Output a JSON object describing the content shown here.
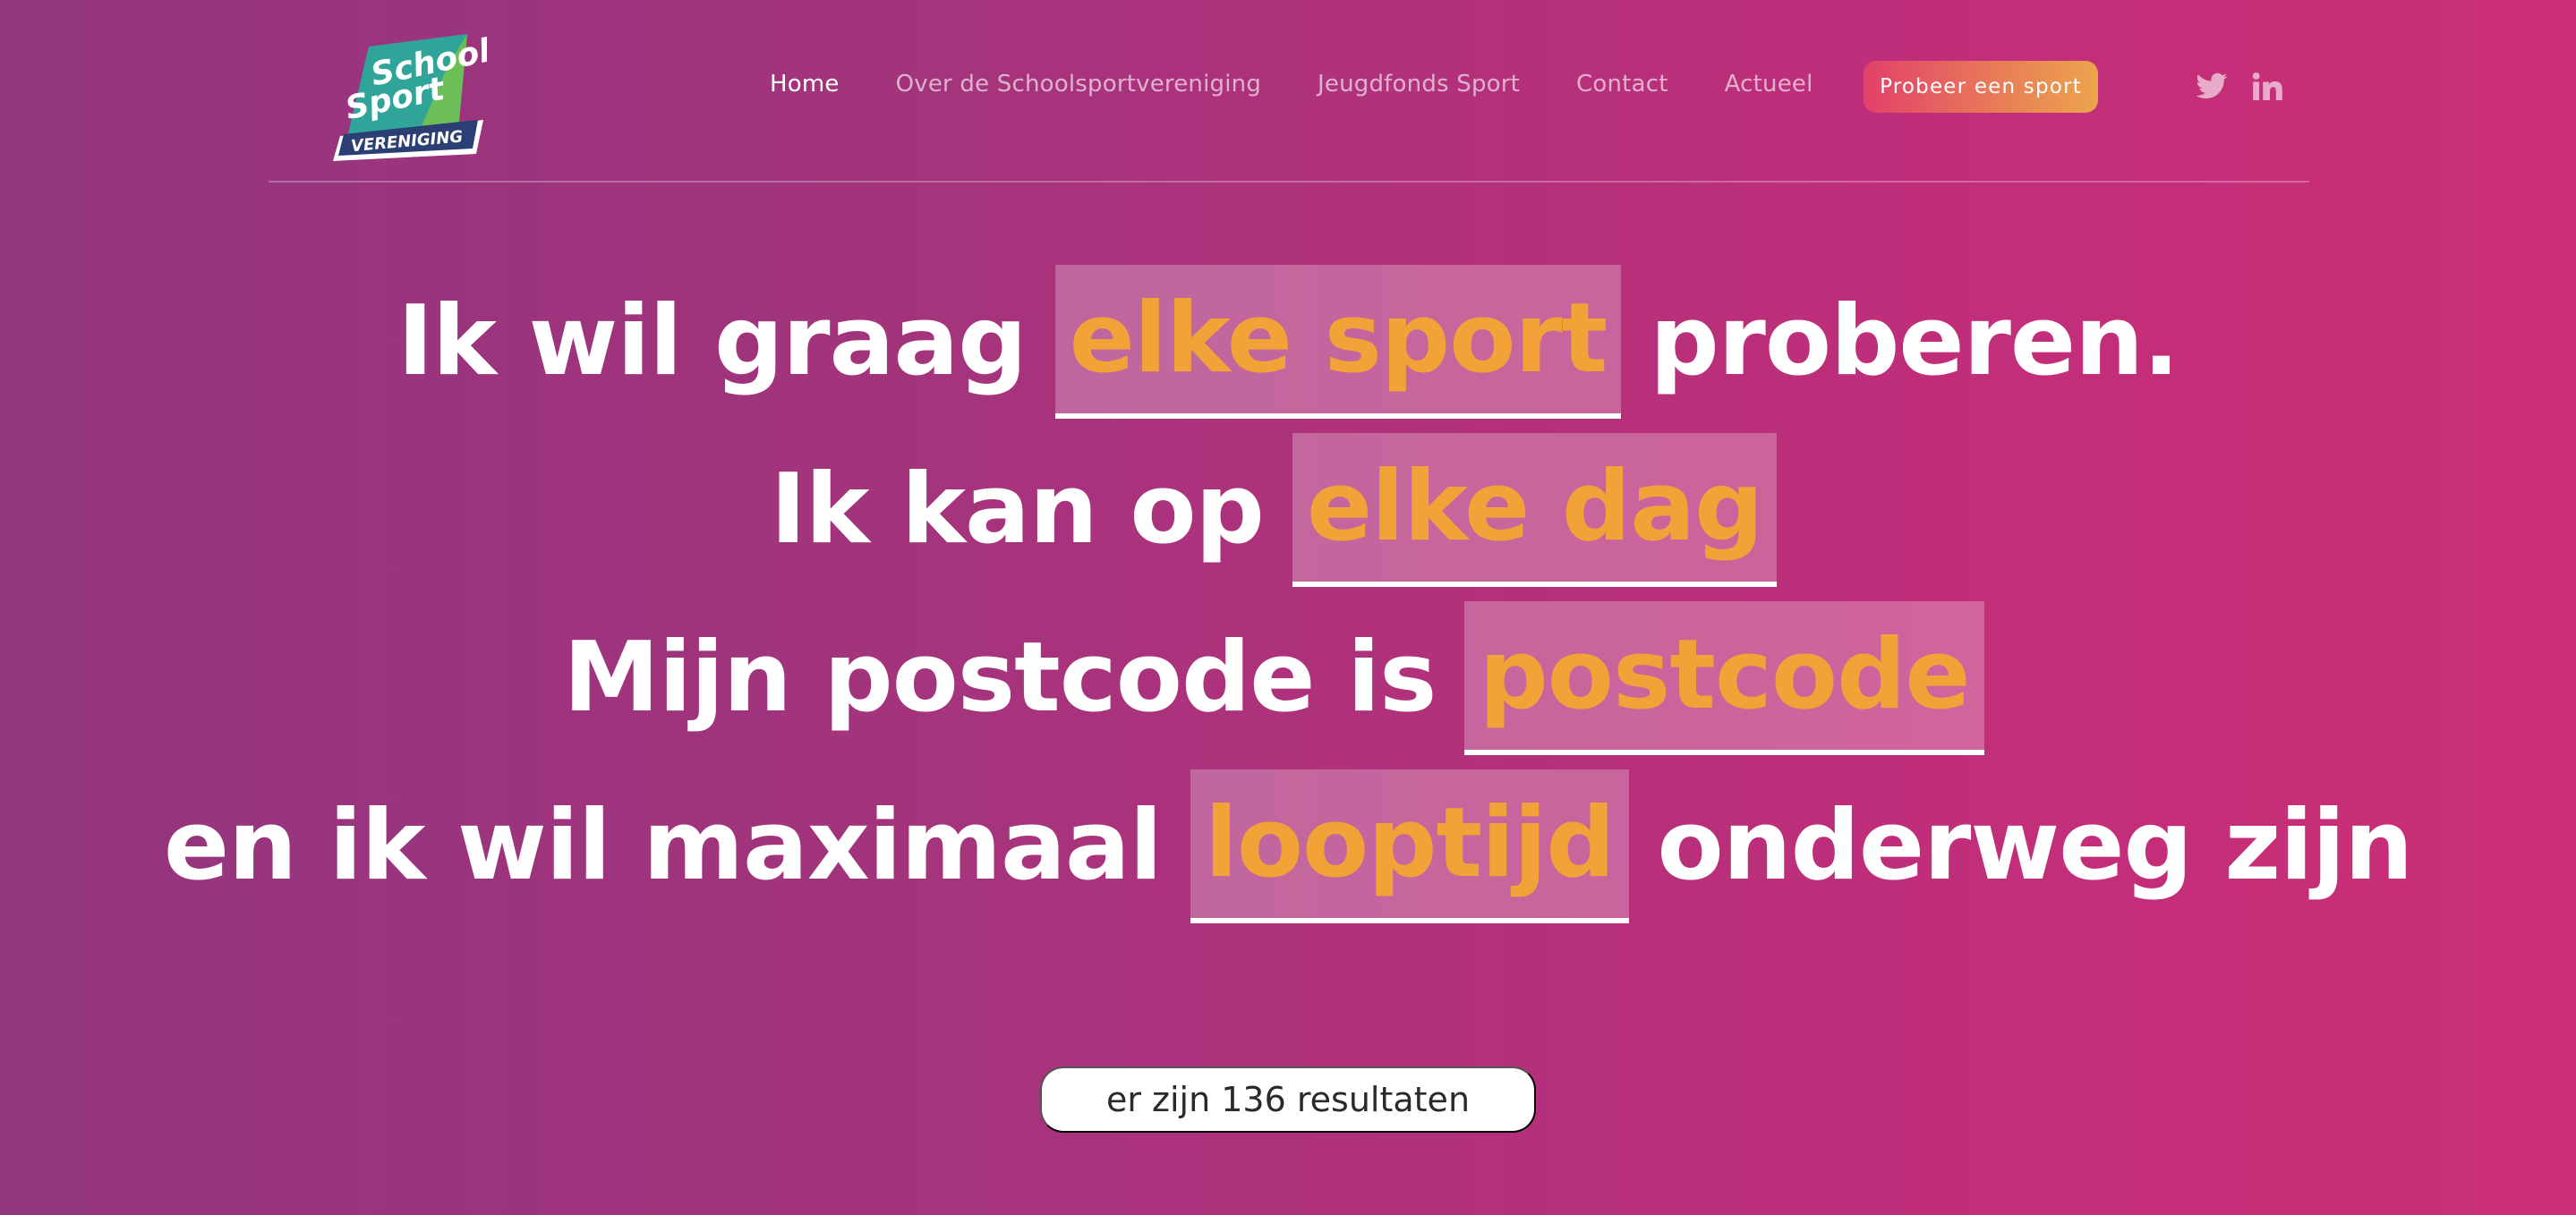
{
  "logo": {
    "line1": "School",
    "line2": "Sport",
    "line3": "VERENIGING"
  },
  "nav": {
    "items": [
      {
        "label": "Home",
        "active": true
      },
      {
        "label": "Over de Schoolsportvereniging",
        "active": false
      },
      {
        "label": "Jeugdfonds Sport",
        "active": false
      },
      {
        "label": "Contact",
        "active": false
      },
      {
        "label": "Actueel",
        "active": false
      }
    ],
    "cta_label": "Probeer een sport"
  },
  "social": {
    "icons": [
      "twitter-icon",
      "linkedin-icon"
    ]
  },
  "sentence": {
    "line1": {
      "before": "Ik wil graag",
      "select": "elke sport",
      "after": "proberen."
    },
    "line2": {
      "before": "Ik kan op",
      "select": "elke dag"
    },
    "line3": {
      "before": "Mijn postcode is",
      "select": "postcode"
    },
    "line4": {
      "before": "en ik wil maximaal",
      "select": "looptijd",
      "after": "onderweg zijn"
    }
  },
  "results": {
    "text": "er zijn 136 resultaten"
  },
  "colors": {
    "background_start": "#93357f",
    "background_end": "#cb2e77",
    "highlight": "#f2a338",
    "cta_start": "#e2406a",
    "cta_end": "#eba54b"
  }
}
